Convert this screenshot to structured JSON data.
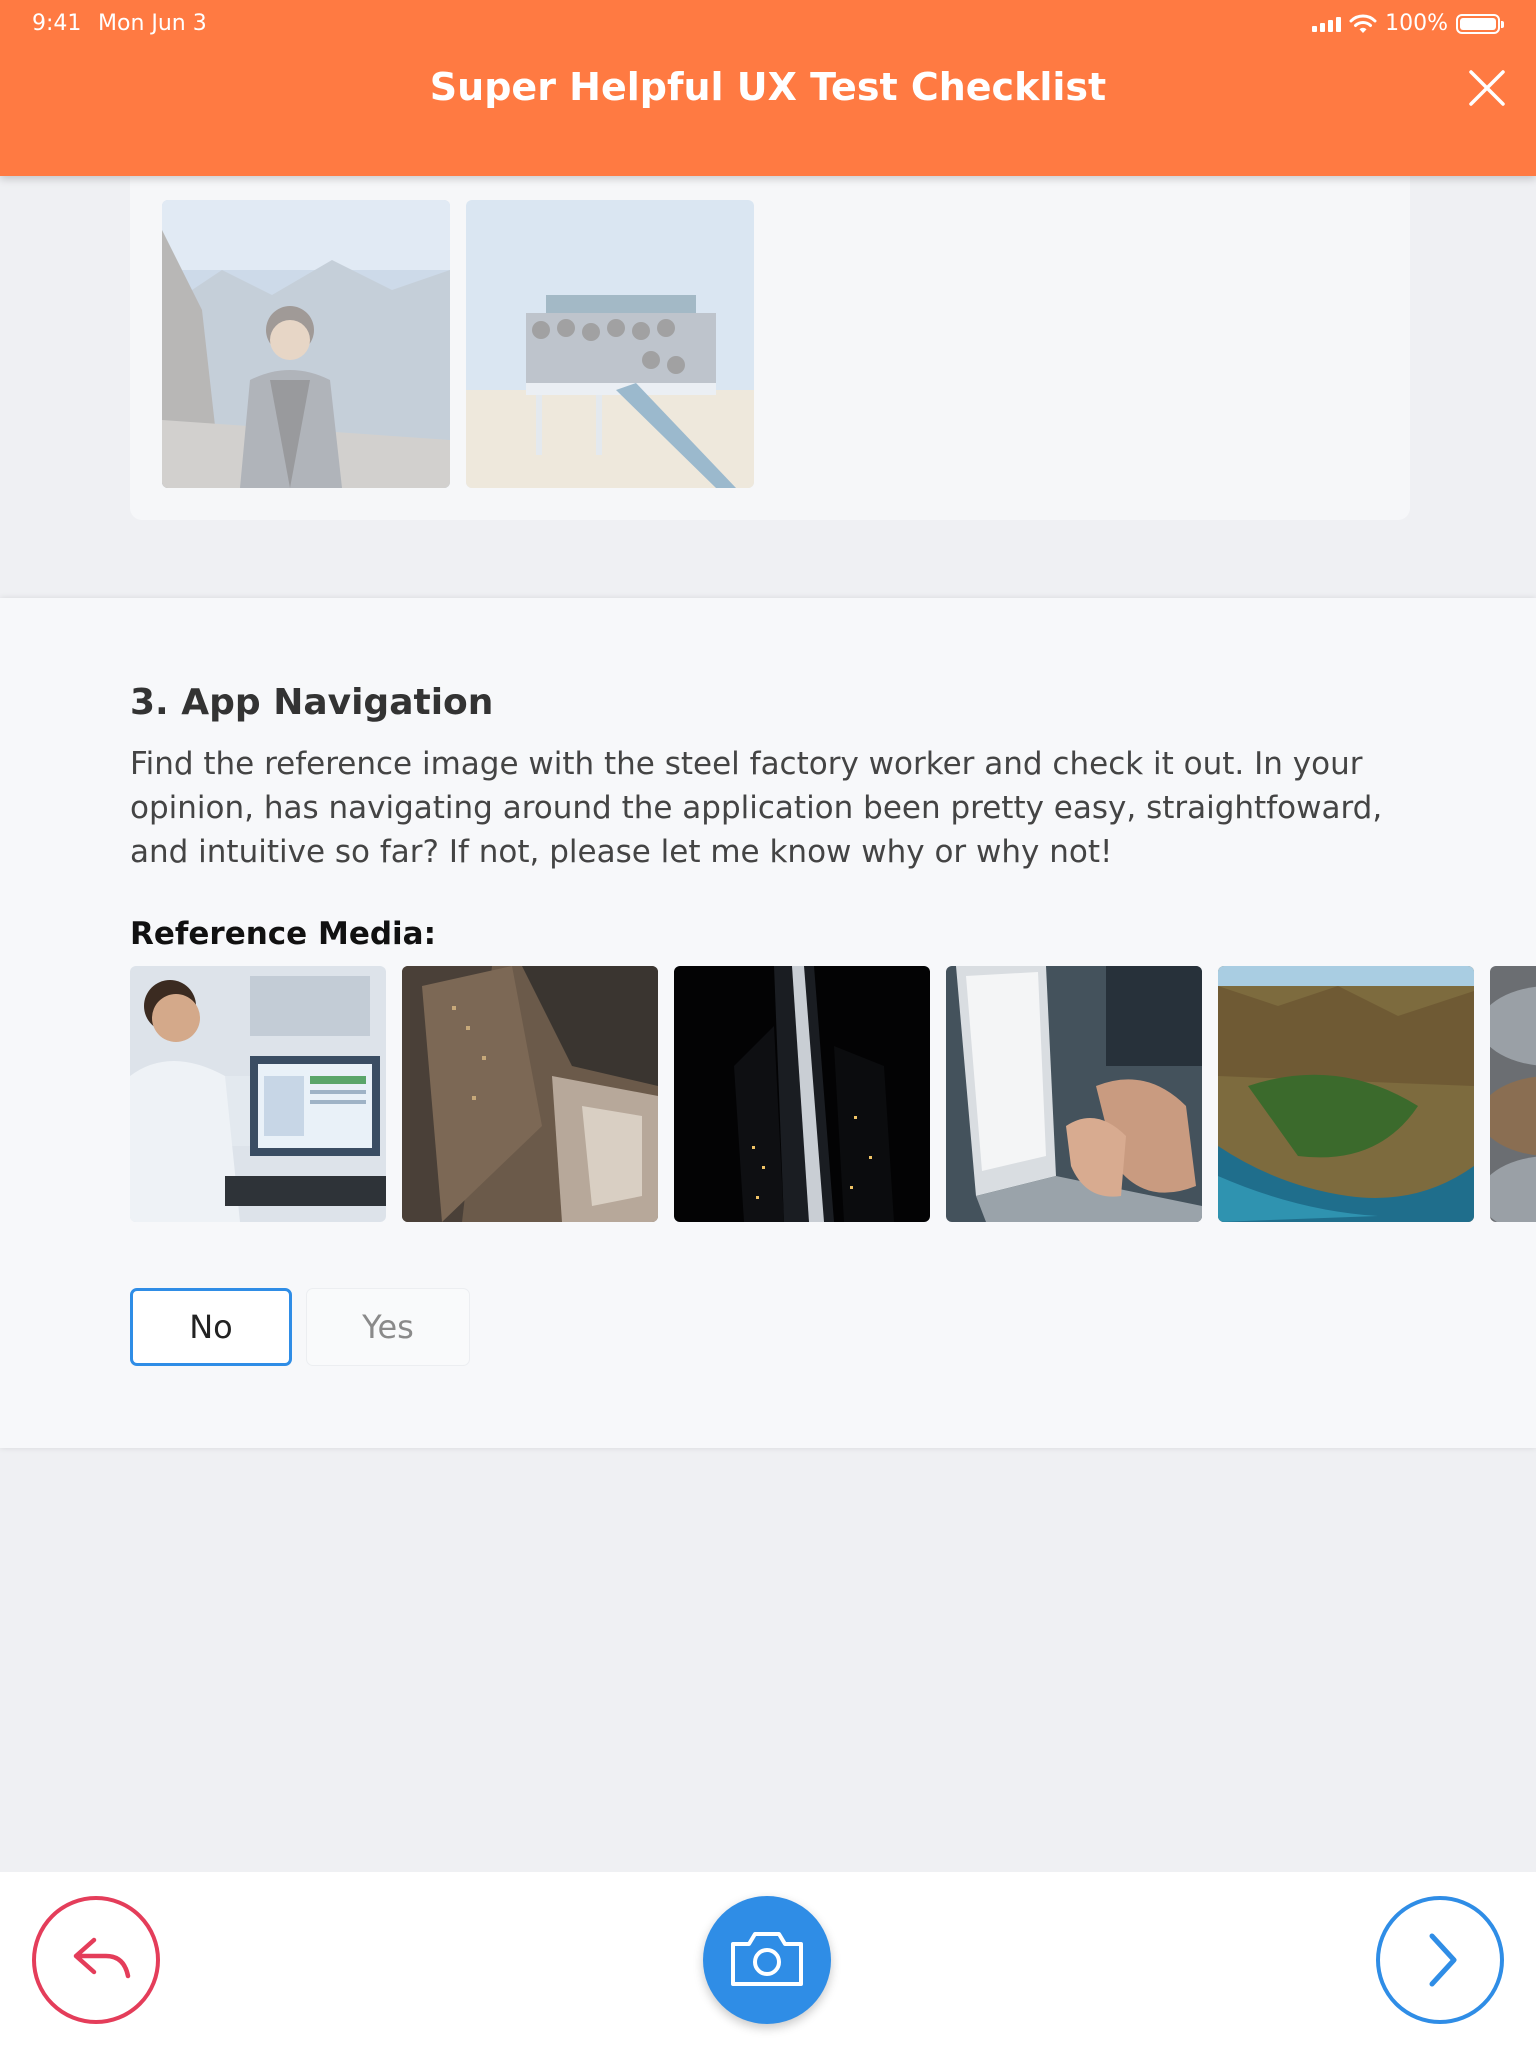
{
  "status_bar": {
    "time": "9:41",
    "date": "Mon Jun 3",
    "battery": "100%"
  },
  "header": {
    "title": "Super Helpful UX Test Checklist",
    "background_color": "#ff7a42",
    "close_icon": "close-icon"
  },
  "previous_question": {
    "media": [
      {
        "name": "person-mountain-photo"
      },
      {
        "name": "group-lifeguard-tower-photo"
      }
    ]
  },
  "question": {
    "title": "3. App Navigation",
    "description": "Find the reference image with the steel factory worker and check it out. In your opinion, has navigating around the application been pretty easy, straightfoward, and intuitive so far? If not, please let me know why or why not!",
    "reference_label": "Reference Media:",
    "media": [
      {
        "name": "office-worker-computer-photo"
      },
      {
        "name": "aerial-city-buildings-photo"
      },
      {
        "name": "night-skyscraper-photo"
      },
      {
        "name": "laptop-typing-photo"
      },
      {
        "name": "aerial-landscape-photo"
      },
      {
        "name": "industrial-tanks-photo"
      }
    ],
    "options": {
      "no": "No",
      "yes": "Yes",
      "selected": "No"
    }
  },
  "bottom_bar": {
    "back_icon": "reply-arrow-icon",
    "camera_icon": "camera-icon",
    "next_icon": "chevron-right-icon",
    "back_color": "#e43d5a",
    "accent_color": "#2f8de6"
  }
}
